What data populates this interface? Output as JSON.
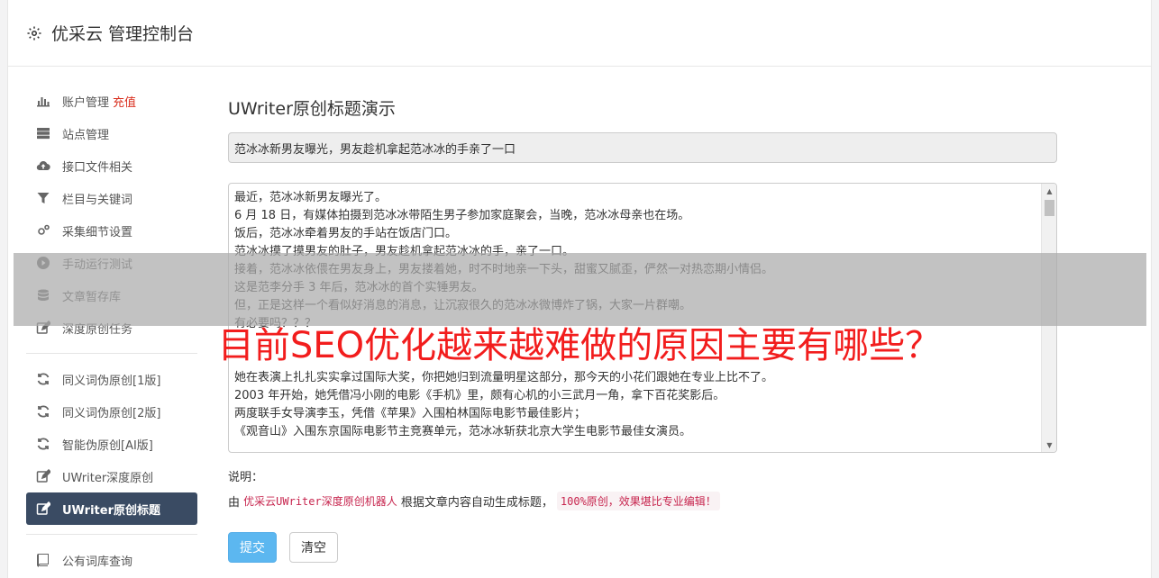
{
  "header": {
    "title": "优采云 管理控制台",
    "icon": "gear-icon"
  },
  "sidebar": {
    "groups": [
      [
        {
          "label": "账户管理",
          "extra": "充值",
          "icon": "bar-chart-icon"
        },
        {
          "label": "站点管理",
          "icon": "server-icon"
        },
        {
          "label": "接口文件相关",
          "icon": "cloud-upload-icon"
        },
        {
          "label": "栏目与关键词",
          "icon": "filter-icon"
        },
        {
          "label": "采集细节设置",
          "icon": "cogs-icon"
        },
        {
          "label": "手动运行测试",
          "icon": "play-circle-icon"
        },
        {
          "label": "文章暂存库",
          "icon": "database-icon"
        },
        {
          "label": "深度原创任务",
          "icon": "edit-icon"
        }
      ],
      [
        {
          "label": "同义词伪原创[1版]",
          "icon": "refresh-icon"
        },
        {
          "label": "同义词伪原创[2版]",
          "icon": "refresh-icon"
        },
        {
          "label": "智能伪原创[AI版]",
          "icon": "refresh-icon"
        },
        {
          "label": "UWriter深度原创",
          "icon": "edit-icon"
        },
        {
          "label": "UWriter原创标题",
          "icon": "edit-icon",
          "active": true
        }
      ],
      [
        {
          "label": "公有词库查询",
          "icon": "book-icon"
        }
      ]
    ]
  },
  "main": {
    "heading": "UWriter原创标题演示",
    "title_value": "范冰冰新男友曝光，男友趁机拿起范冰冰的手亲了一口",
    "content_lines": [
      "最近，范冰冰新男友曝光了。",
      "6 月 18 日，有媒体拍摄到范冰冰带陌生男子参加家庭聚会，当晚，范冰冰母亲也在场。",
      "饭后，范冰冰牵着男友的手站在饭店门口。",
      "范冰冰摸了摸男友的肚子，男友趁机拿起范冰冰的手，亲了一口。",
      "接着，范冰冰依偎在男友身上，男友搂着她，时不时地亲一下头，甜蜜又腻歪，俨然一对热恋期小情侣。",
      "这是范李分手 3 年后，范冰冰的首个实锤男友。",
      "但，正是这样一个看似好消息的消息，让沉寂很久的范冰冰微博炸了锅，大家一片群嘲。",
      "有必要吗？？？",
      "",
      "",
      "她在表演上扎扎实实拿过国际大奖，你把她归到流量明星这部分，那今天的小花们跟她在专业上比不了。",
      "2003 年开始，她凭借冯小刚的电影《手机》里，颇有心机的小三武月一角，拿下百花奖影后。",
      "两度联手女导演李玉，凭借《苹果》入围柏林国际电影节最佳影片；",
      "《观音山》入围东京国际电影节主竞赛单元，范冰冰斩获北京大学生电影节最佳女演员。"
    ],
    "note_label": "说明：",
    "note_prefix": "由",
    "note_highlight": "优采云UWriter深度原创机器人",
    "note_middle": "根据文章内容自动生成标题，",
    "note_code": "100%原创，效果堪比专业编辑！",
    "submit_label": "提交",
    "clear_label": "清空"
  },
  "overlay": {
    "title": "目前SEO优化越来越难做的原因主要有哪些？"
  },
  "colors": {
    "active_nav": "#3a4b63",
    "primary_button": "#5cb7f0",
    "accent_red": "#d9301f",
    "overlay_title": "#f21d1d"
  }
}
